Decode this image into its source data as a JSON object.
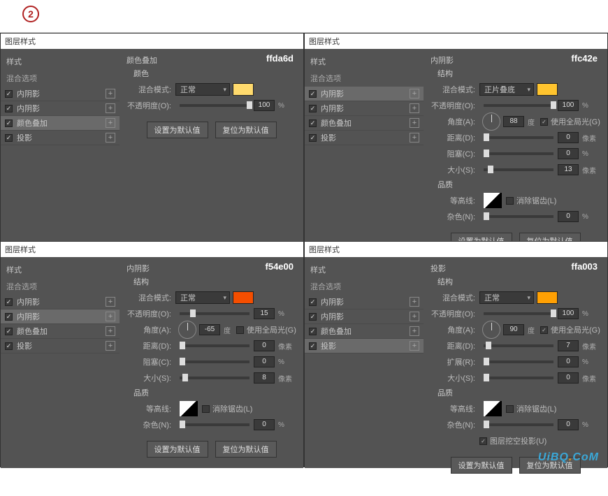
{
  "stepNumber": "2",
  "labels": {
    "panelTitle": "图层样式",
    "styles": "样式",
    "blendOptions": "混合选项",
    "innerShadow": "内阴影",
    "colorOverlay": "颜色叠加",
    "dropShadow": "投影",
    "structure": "结构",
    "color": "颜色",
    "blendMode": "混合模式:",
    "opacity": "不透明度(O):",
    "angle": "角度(A):",
    "distance": "距离(D):",
    "choke": "阻塞(C):",
    "spread": "扩展(R):",
    "size": "大小(S):",
    "noise": "杂色(N):",
    "quality": "品质",
    "contour": "等高线:",
    "antiAlias": "消除锯齿(L)",
    "useGlobal": "使用全局光(G)",
    "knockout": "图层挖空投影(U)",
    "degree": "度",
    "px": "像素",
    "pct": "%",
    "setDefault": "设置为默认值",
    "resetDefault": "复位为默认值",
    "modeNormal": "正常",
    "modeMultiply": "正片叠底"
  },
  "panels": {
    "p1": {
      "effect": "颜色叠加",
      "colorHex": "ffda6d",
      "sidebar": [
        "内阴影",
        "内阴影",
        "颜色叠加",
        "投影"
      ],
      "selected": 2,
      "mode": "正常",
      "opacity": "100"
    },
    "p2": {
      "effect": "内阴影",
      "colorHex": "ffc42e",
      "sidebar": [
        "内阴影",
        "内阴影",
        "颜色叠加",
        "投影"
      ],
      "selected": 0,
      "mode": "正片叠底",
      "opacity": "100",
      "angle": "88",
      "useGlobal": true,
      "distance": "0",
      "choke": "0",
      "size": "13",
      "noise": "0"
    },
    "p3": {
      "effect": "内阴影",
      "colorHex": "f54e00",
      "sidebar": [
        "内阴影",
        "内阴影",
        "颜色叠加",
        "投影"
      ],
      "selected": 1,
      "mode": "正常",
      "opacity": "15",
      "angle": "-65",
      "useGlobal": false,
      "distance": "0",
      "choke": "0",
      "size": "8",
      "noise": "0"
    },
    "p4": {
      "effect": "投影",
      "colorHex": "ffa003",
      "sidebar": [
        "内阴影",
        "内阴影",
        "颜色叠加",
        "投影"
      ],
      "selected": 3,
      "mode": "正常",
      "opacity": "100",
      "angle": "90",
      "useGlobal": true,
      "distance": "7",
      "spread": "0",
      "size": "0",
      "noise": "0",
      "knockout": true
    }
  },
  "watermark": "UiBQ.CoM"
}
